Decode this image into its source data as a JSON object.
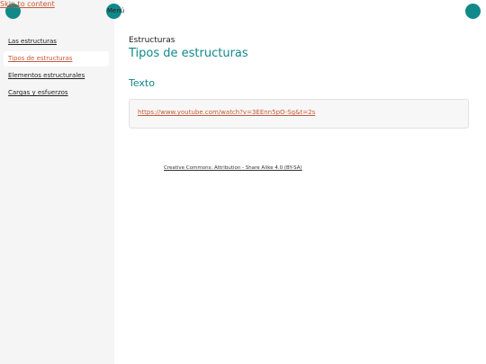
{
  "skip_link": "Skip to content",
  "header": {
    "menu_label": "Menú"
  },
  "sidebar": {
    "items": [
      {
        "label": "Las estructuras"
      },
      {
        "label": "Tipos de estructuras",
        "active": true
      },
      {
        "label": "Elementos estructurales"
      },
      {
        "label": "Cargas y esfuerzos"
      }
    ]
  },
  "main": {
    "section_label": "Estructuras",
    "page_title": "Tipos de estructuras",
    "sub_heading": "Texto",
    "video_link": "https://www.youtube.com/watch?v=3EEnn5pO-Sg&t=2s"
  },
  "footer": {
    "license": "Creative Commons: Attribution - Share Alike 4.0 (BY-SA)"
  },
  "colors": {
    "accent": "#11888a",
    "link": "#c65a3a",
    "sidebar_bg": "#f5f5f5"
  }
}
